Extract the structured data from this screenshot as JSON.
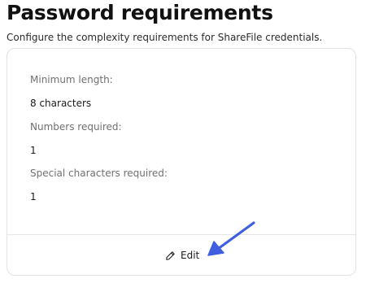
{
  "page": {
    "title": "Password requirements",
    "subtitle": "Configure the complexity requirements for ShareFile credentials."
  },
  "requirements": [
    {
      "label": "Minimum length:",
      "value": "8 characters"
    },
    {
      "label": "Numbers required:",
      "value": "1"
    },
    {
      "label": "Special characters required:",
      "value": "1"
    }
  ],
  "actions": {
    "edit_label": "Edit",
    "edit_icon": "pencil-icon"
  },
  "colors": {
    "annotation_arrow": "#3f5ee0",
    "card_border": "#e2e2e2",
    "label_text": "#707070"
  }
}
